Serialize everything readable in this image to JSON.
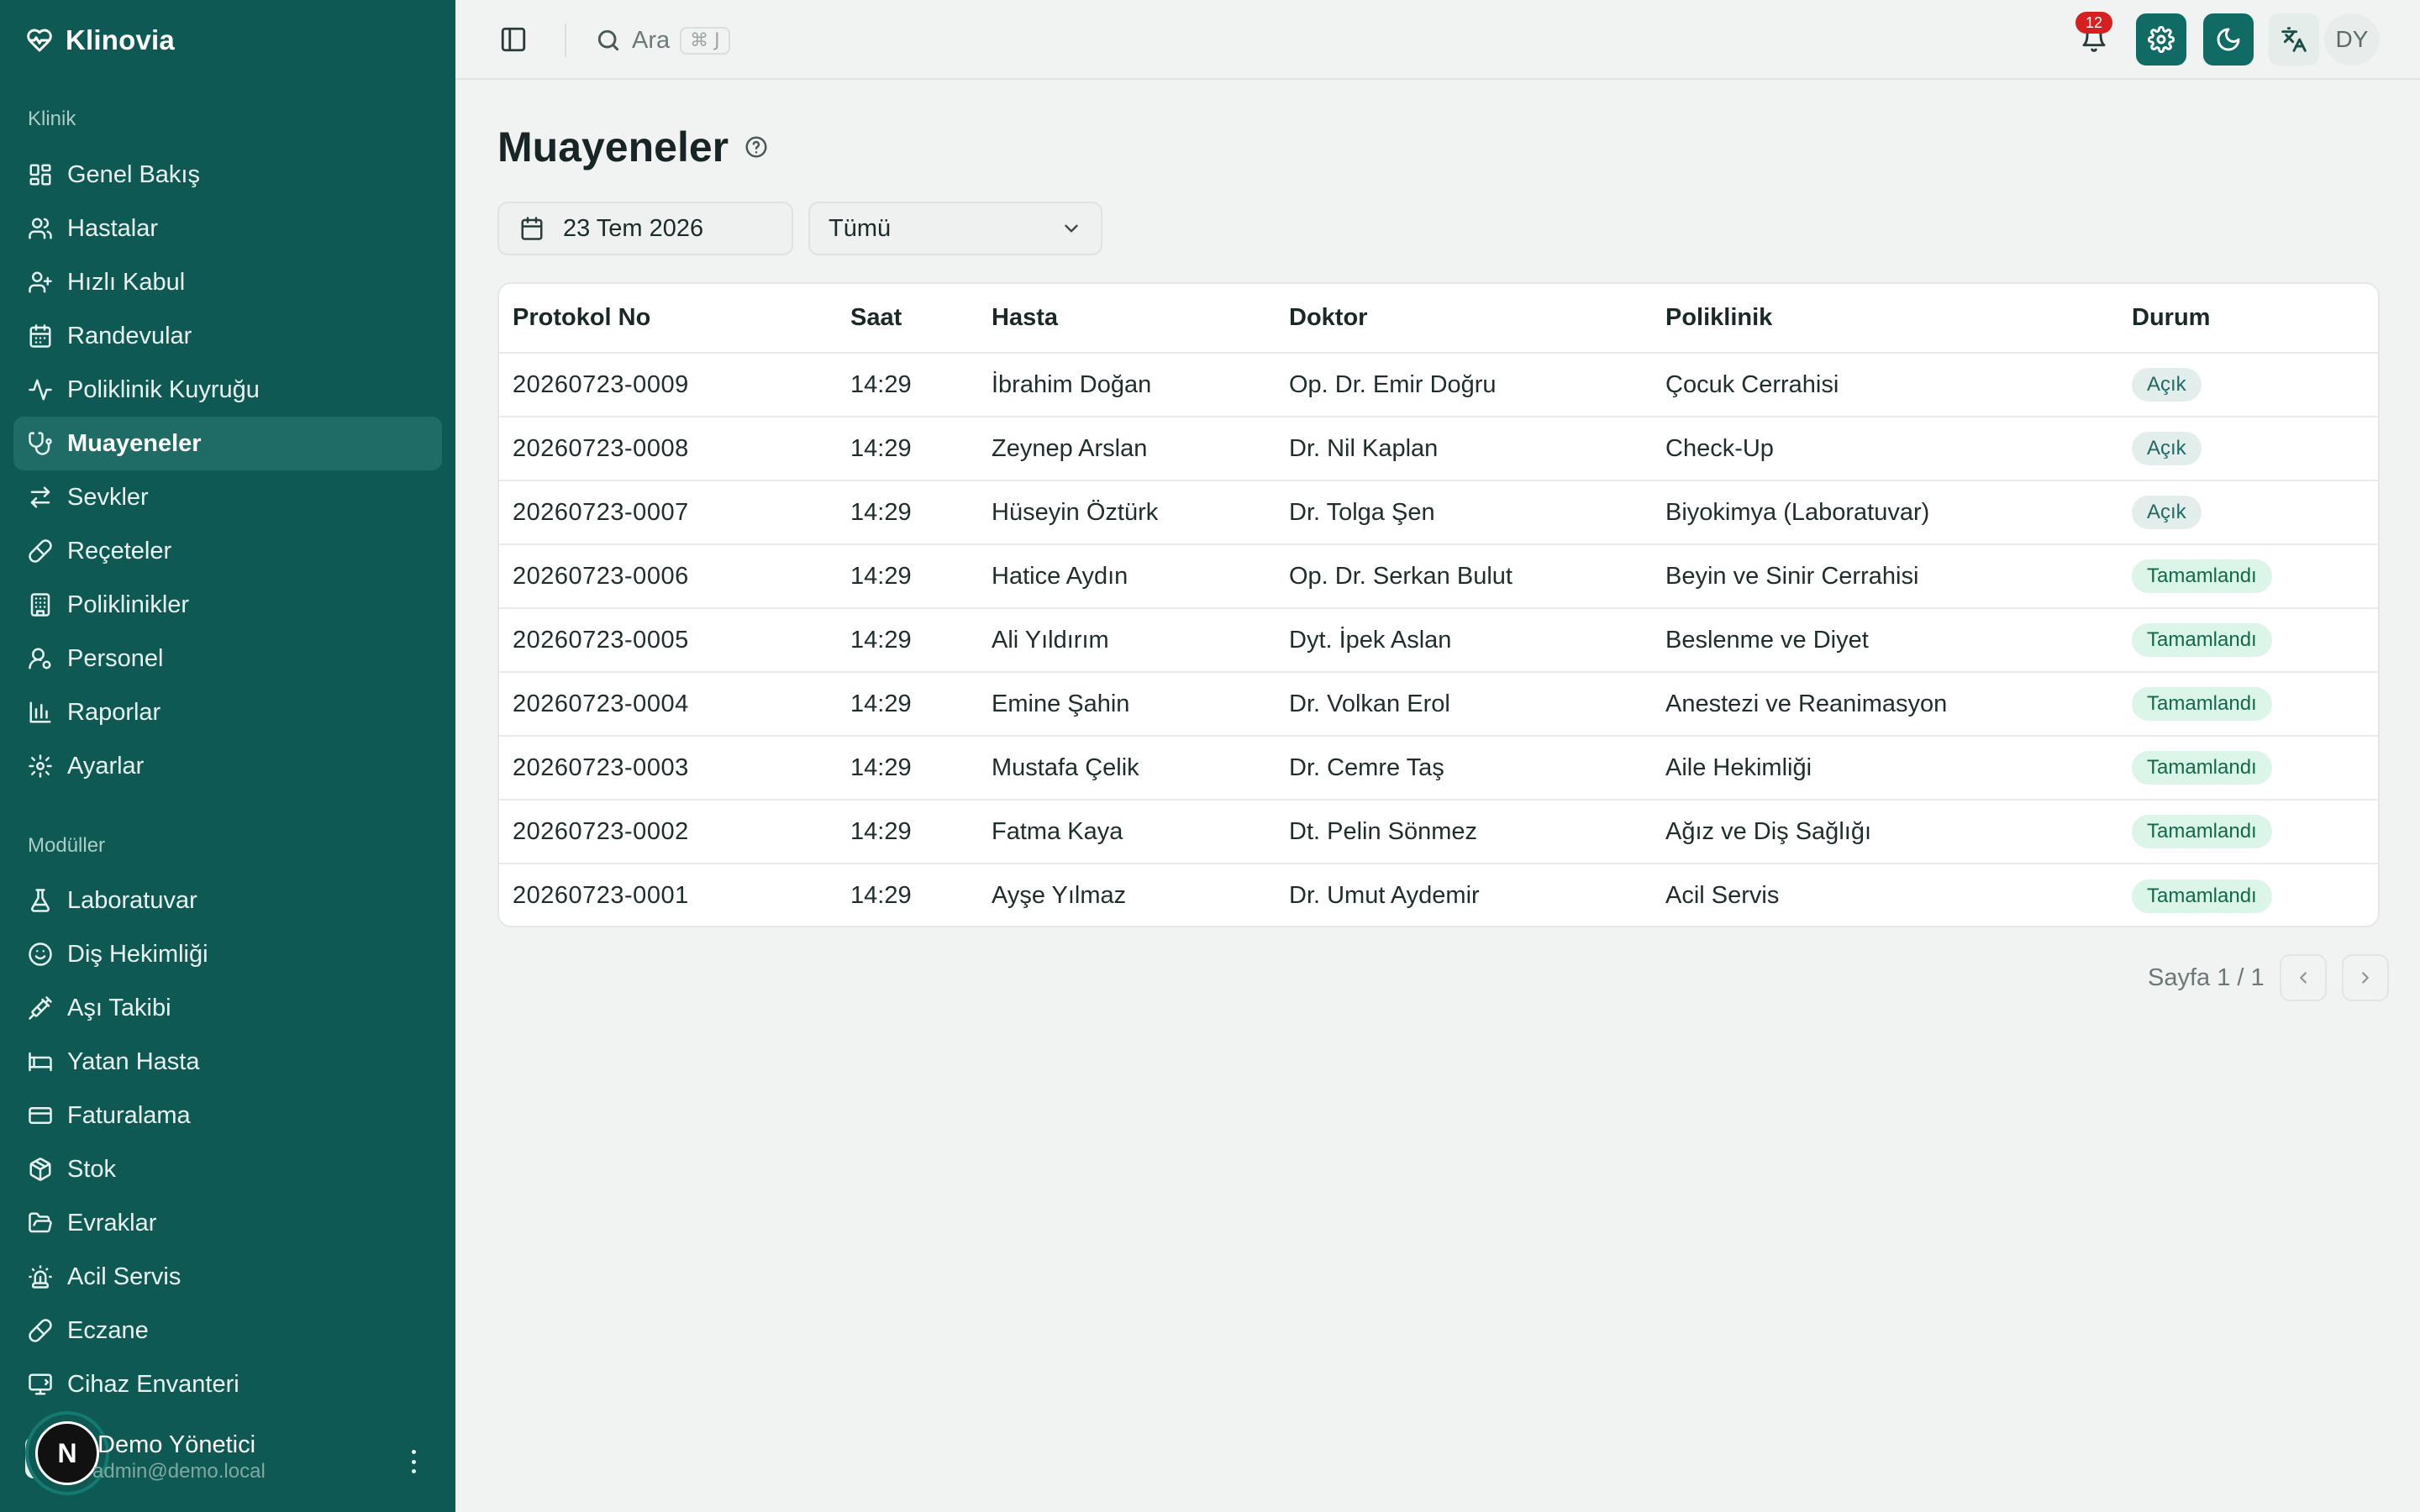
{
  "app": {
    "name": "Klinovia"
  },
  "sidebar": {
    "section_clinic": "Klinik",
    "clinic_items": [
      {
        "label": "Genel Bakış",
        "icon": "dashboard-icon"
      },
      {
        "label": "Hastalar",
        "icon": "users-icon"
      },
      {
        "label": "Hızlı Kabul",
        "icon": "user-plus-icon"
      },
      {
        "label": "Randevular",
        "icon": "calendar-icon"
      },
      {
        "label": "Poliklinik Kuyruğu",
        "icon": "activity-icon"
      },
      {
        "label": "Muayeneler",
        "icon": "stethoscope-icon",
        "active": true
      },
      {
        "label": "Sevkler",
        "icon": "transfer-icon"
      },
      {
        "label": "Reçeteler",
        "icon": "pill-icon"
      },
      {
        "label": "Poliklinikler",
        "icon": "building-icon"
      },
      {
        "label": "Personel",
        "icon": "staff-icon"
      },
      {
        "label": "Raporlar",
        "icon": "bar-chart-icon"
      },
      {
        "label": "Ayarlar",
        "icon": "gear-icon"
      }
    ],
    "section_modules": "Modüller",
    "module_items": [
      {
        "label": "Laboratuvar",
        "icon": "flask-icon"
      },
      {
        "label": "Diş Hekimliği",
        "icon": "smile-icon"
      },
      {
        "label": "Aşı Takibi",
        "icon": "syringe-icon"
      },
      {
        "label": "Yatan Hasta",
        "icon": "bed-icon"
      },
      {
        "label": "Faturalama",
        "icon": "credit-card-icon"
      },
      {
        "label": "Stok",
        "icon": "package-icon"
      },
      {
        "label": "Evraklar",
        "icon": "folder-icon"
      },
      {
        "label": "Acil Servis",
        "icon": "siren-icon"
      },
      {
        "label": "Eczane",
        "icon": "pill-icon"
      },
      {
        "label": "Cihaz Envanteri",
        "icon": "monitor-icon"
      }
    ],
    "user": {
      "badge": "N",
      "name": "Demo Yönetici",
      "email": "admin@demo.local"
    }
  },
  "topbar": {
    "search_label": "Ara",
    "search_shortcut": "⌘ J",
    "notification_count": "12",
    "avatar_initials": "DY"
  },
  "main": {
    "title": "Muayeneler",
    "date_filter": "23 Tem 2026",
    "status_filter": "Tümü",
    "table": {
      "headers": [
        "Protokol No",
        "Saat",
        "Hasta",
        "Doktor",
        "Poliklinik",
        "Durum"
      ],
      "rows": [
        {
          "protocol": "20260723-0009",
          "time": "14:29",
          "patient": "İbrahim Doğan",
          "doctor": "Op. Dr. Emir Doğru",
          "clinic": "Çocuk Cerrahisi",
          "status": "Açık",
          "status_type": "open"
        },
        {
          "protocol": "20260723-0008",
          "time": "14:29",
          "patient": "Zeynep Arslan",
          "doctor": "Dr. Nil Kaplan",
          "clinic": "Check-Up",
          "status": "Açık",
          "status_type": "open"
        },
        {
          "protocol": "20260723-0007",
          "time": "14:29",
          "patient": "Hüseyin Öztürk",
          "doctor": "Dr. Tolga Şen",
          "clinic": "Biyokimya (Laboratuvar)",
          "status": "Açık",
          "status_type": "open"
        },
        {
          "protocol": "20260723-0006",
          "time": "14:29",
          "patient": "Hatice Aydın",
          "doctor": "Op. Dr. Serkan Bulut",
          "clinic": "Beyin ve Sinir Cerrahisi",
          "status": "Tamamlandı",
          "status_type": "done"
        },
        {
          "protocol": "20260723-0005",
          "time": "14:29",
          "patient": "Ali Yıldırım",
          "doctor": "Dyt. İpek Aslan",
          "clinic": "Beslenme ve Diyet",
          "status": "Tamamlandı",
          "status_type": "done"
        },
        {
          "protocol": "20260723-0004",
          "time": "14:29",
          "patient": "Emine Şahin",
          "doctor": "Dr. Volkan Erol",
          "clinic": "Anestezi ve Reanimasyon",
          "status": "Tamamlandı",
          "status_type": "done"
        },
        {
          "protocol": "20260723-0003",
          "time": "14:29",
          "patient": "Mustafa Çelik",
          "doctor": "Dr. Cemre Taş",
          "clinic": "Aile Hekimliği",
          "status": "Tamamlandı",
          "status_type": "done"
        },
        {
          "protocol": "20260723-0002",
          "time": "14:29",
          "patient": "Fatma Kaya",
          "doctor": "Dt. Pelin Sönmez",
          "clinic": "Ağız ve Diş Sağlığı",
          "status": "Tamamlandı",
          "status_type": "done"
        },
        {
          "protocol": "20260723-0001",
          "time": "14:29",
          "patient": "Ayşe Yılmaz",
          "doctor": "Dr. Umut Aydemir",
          "clinic": "Acil Servis",
          "status": "Tamamlandı",
          "status_type": "done"
        }
      ]
    },
    "pagination": {
      "label": "Sayfa 1 / 1"
    }
  },
  "colors": {
    "sidebar": "#0f5954",
    "accent": "#0f6b64",
    "badge_open": "#e3eeec",
    "badge_done": "#dbf5e9",
    "notification": "#d61f1f"
  }
}
